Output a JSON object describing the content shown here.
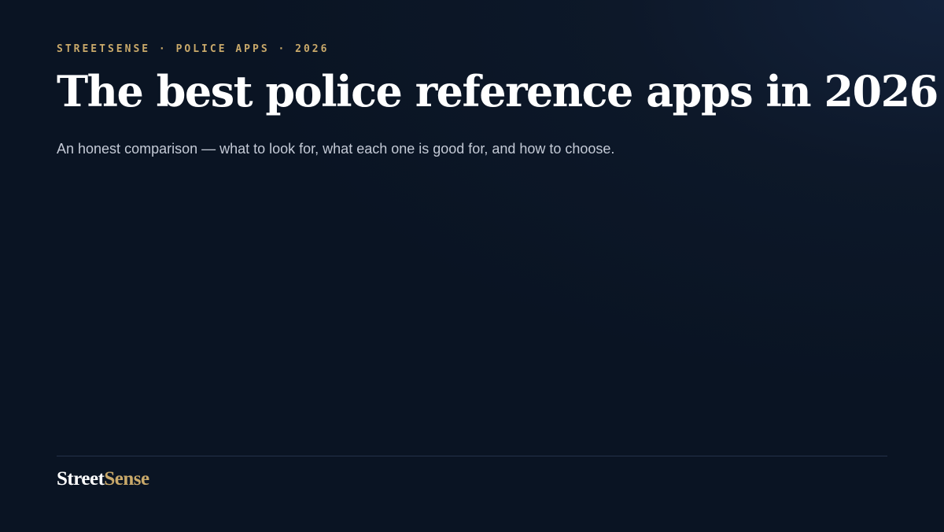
{
  "kicker": "STREETSENSE · POLICE APPS · 2026",
  "headline": "The best police reference apps in 2026",
  "subtitle": "An honest comparison — what to look for, what each one is good for, and how to choose.",
  "brand": {
    "part1": "Street",
    "part2": "Sense"
  },
  "colors": {
    "accent": "#c9a96a",
    "headline": "#ffffff",
    "subtitle": "#c4cad6",
    "background": "#0b1525",
    "divider": "#24324a"
  }
}
